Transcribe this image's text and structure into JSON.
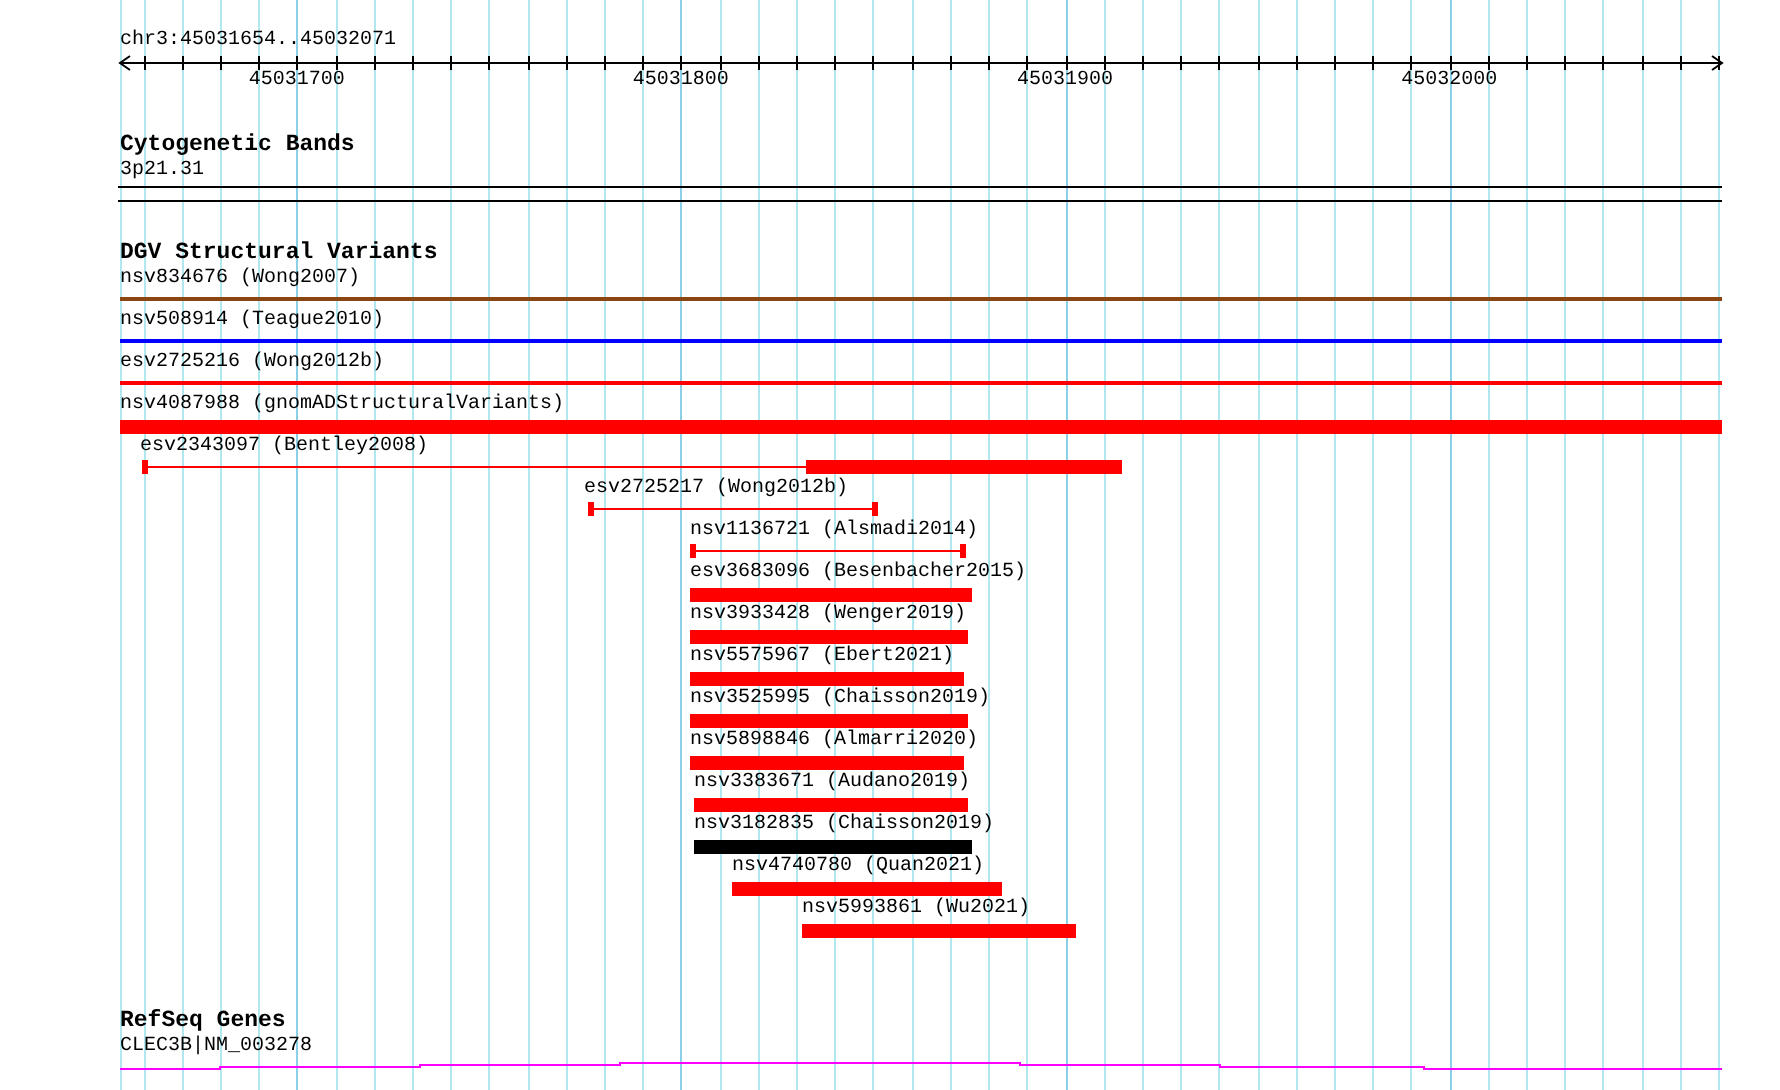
{
  "location": "chr3:45031654..45032071",
  "ruler": {
    "ticks": [
      "45031700",
      "45031800",
      "45031900",
      "45032000"
    ]
  },
  "tracks": [
    {
      "title": "Cytogenetic Bands",
      "kind": "cytoband",
      "features": [
        {
          "label": "3p21.31"
        }
      ]
    },
    {
      "title": "DGV Structural Variants",
      "kind": "variants",
      "features": [
        {
          "label": "nsv834676 (Wong2007)",
          "kind": "line",
          "color": "#8b4513"
        },
        {
          "label": "nsv508914 (Teague2010)",
          "kind": "line",
          "color": "#0000ff"
        },
        {
          "label": "esv2725216 (Wong2012b)",
          "kind": "line",
          "color": "#ff0000"
        },
        {
          "label": "nsv4087988 (gnomADStructuralVariants)",
          "kind": "bar",
          "color": "#ff0000"
        },
        {
          "label": "esv2343097 (Bentley2008)",
          "kind": "split",
          "color": "#ff0000"
        },
        {
          "label": "esv2725217 (Wong2012b)",
          "kind": "span",
          "color": "#ff0000"
        },
        {
          "label": "nsv1136721 (Alsmadi2014)",
          "kind": "span",
          "color": "#ff0000"
        },
        {
          "label": "esv3683096 (Besenbacher2015)",
          "kind": "bar",
          "color": "#ff0000"
        },
        {
          "label": "nsv3933428 (Wenger2019)",
          "kind": "bar",
          "color": "#ff0000"
        },
        {
          "label": "nsv5575967 (Ebert2021)",
          "kind": "bar",
          "color": "#ff0000"
        },
        {
          "label": "nsv3525995 (Chaisson2019)",
          "kind": "bar",
          "color": "#ff0000"
        },
        {
          "label": "nsv5898846 (Almarri2020)",
          "kind": "bar",
          "color": "#ff0000"
        },
        {
          "label": "nsv3383671 (Audano2019)",
          "kind": "bar",
          "color": "#ff0000"
        },
        {
          "label": "nsv3182835 (Chaisson2019)",
          "kind": "bar",
          "color": "#000000"
        },
        {
          "label": "nsv4740780 (Quan2021)",
          "kind": "bar",
          "color": "#ff0000"
        },
        {
          "label": "nsv5993861 (Wu2021)",
          "kind": "bar",
          "color": "#ff0000"
        }
      ]
    },
    {
      "title": "RefSeq Genes",
      "kind": "gene",
      "features": [
        {
          "label": "CLEC3B|NM_003278"
        }
      ]
    }
  ]
}
